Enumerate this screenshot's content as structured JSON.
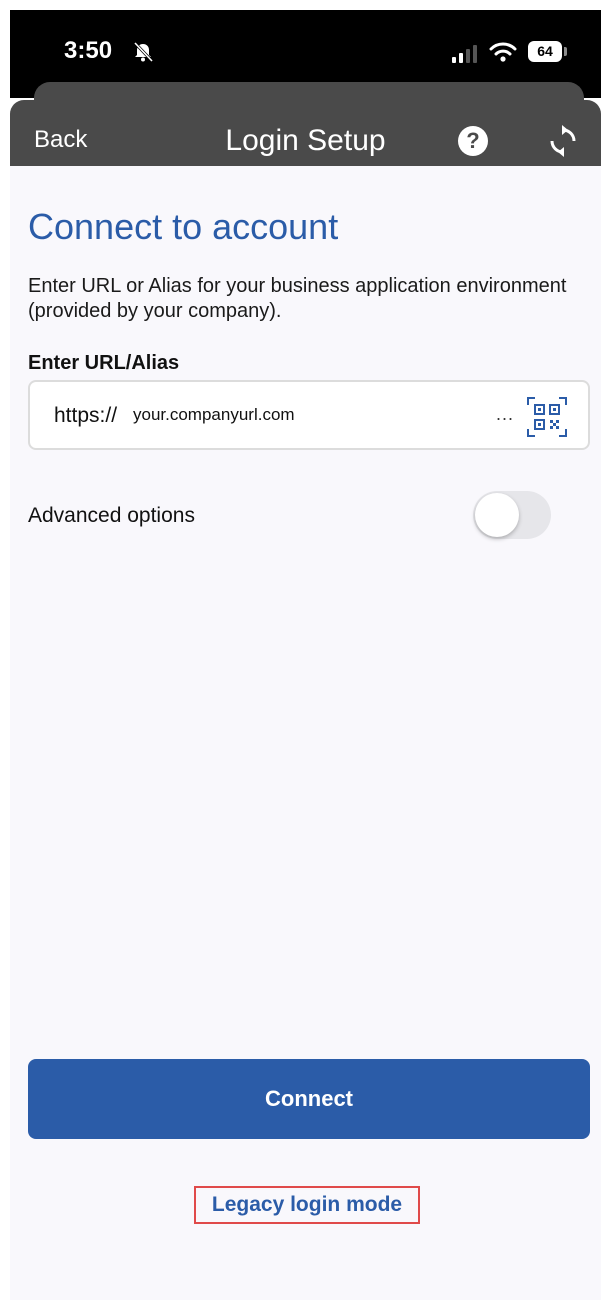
{
  "status_bar": {
    "time": "3:50",
    "battery": "64",
    "icons": [
      "bell-slash-icon",
      "signal-icon",
      "wifi-icon",
      "battery-icon"
    ]
  },
  "nav": {
    "back_label": "Back",
    "title": "Login Setup",
    "icons": [
      "help-icon",
      "refresh-icon"
    ]
  },
  "main": {
    "heading": "Connect to account",
    "description": "Enter URL or Alias for your business application environment (provided by your company).",
    "field_label": "Enter URL/Alias",
    "url_prefix": "https://",
    "url_placeholder": "your.companyurl.com",
    "more_label": "...",
    "advanced_label": "Advanced options",
    "advanced_enabled": false,
    "connect_label": "Connect",
    "legacy_label": "Legacy login mode"
  },
  "colors": {
    "accent": "#2b5ca8",
    "nav_bg": "#4a4a4a",
    "highlight_border": "#e04a4a"
  }
}
